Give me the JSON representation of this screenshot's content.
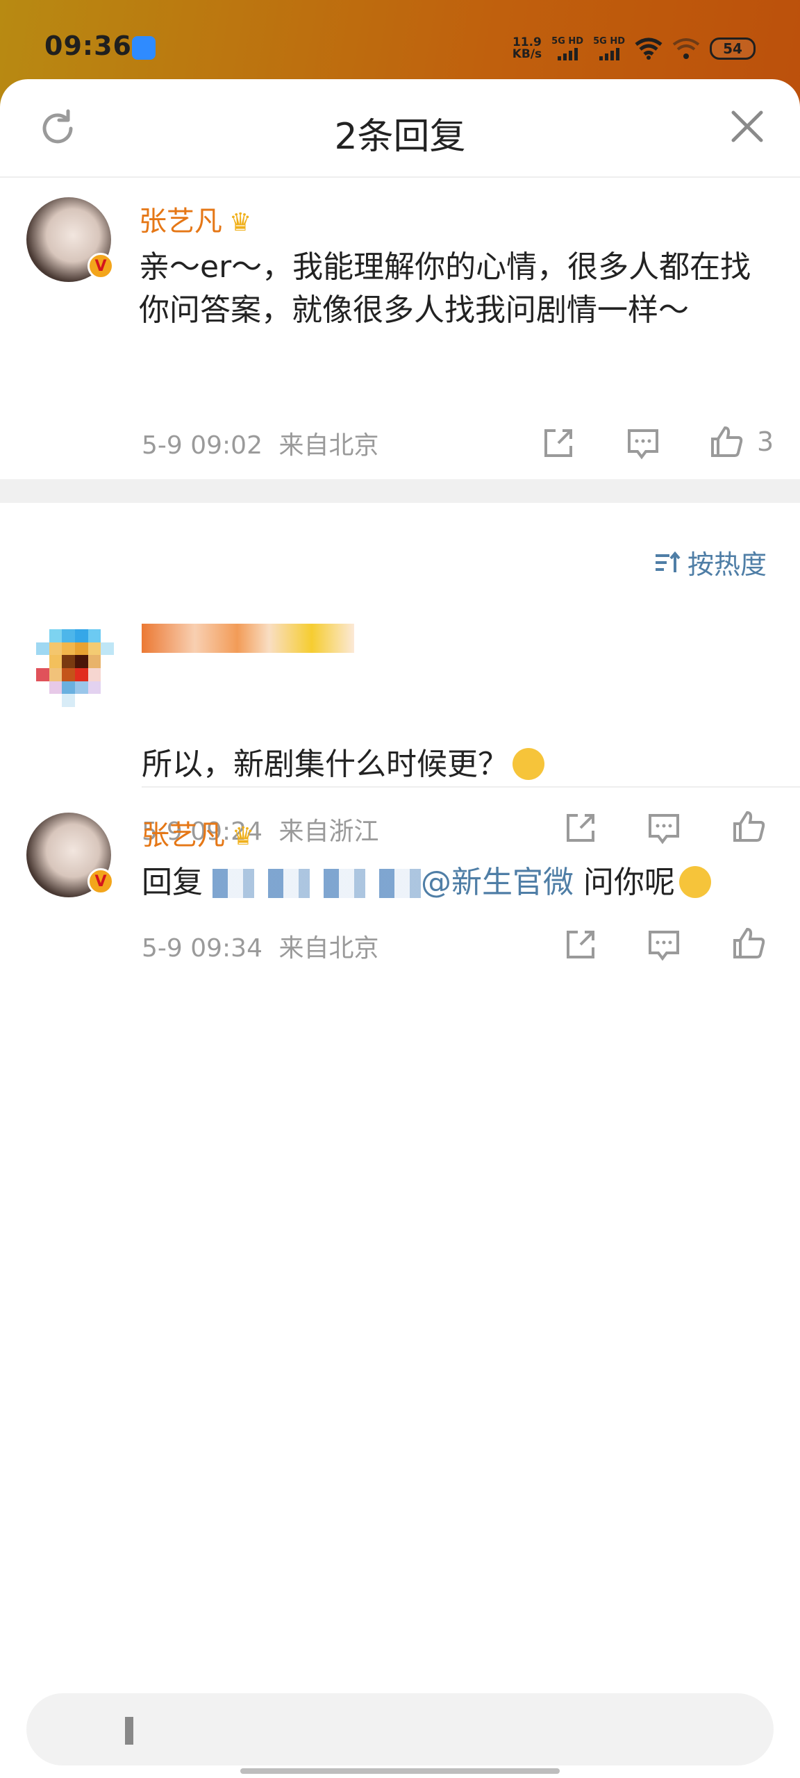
{
  "status_bar": {
    "time": "09:36",
    "net_speed_value": "11.9",
    "net_speed_unit": "KB/s",
    "sim1_label": "5G HD",
    "sim2_label": "5G HD",
    "battery": "54"
  },
  "header": {
    "title": "2条回复"
  },
  "root_comment": {
    "user": "张艺凡",
    "content": "亲～er～，我能理解你的心情，很多人都在找你问答案，就像很多人找我问剧情一样～",
    "time": "5-9 09:02",
    "location": "来自北京",
    "likes": "3"
  },
  "sort": {
    "label": "按热度"
  },
  "replies": [
    {
      "content": "所以，新剧集什么时候更？",
      "time": "5-9 09:24",
      "location": "来自浙江"
    },
    {
      "user": "张艺凡",
      "reply_prefix": "回复",
      "mention": "@新生官微",
      "content_suffix": "问你呢",
      "time": "5-9 09:34",
      "location": "来自北京"
    }
  ],
  "colors": {
    "username": "#e57716",
    "link": "#4f7ea6",
    "meta": "#9a9a9a"
  },
  "icons": {
    "refresh": "refresh-icon",
    "close": "close-icon",
    "share": "share-icon",
    "comment": "comment-icon",
    "like": "thumbs-up-icon",
    "sort": "sort-icon",
    "crown": "crown-icon",
    "verified": "verified-v-icon"
  }
}
